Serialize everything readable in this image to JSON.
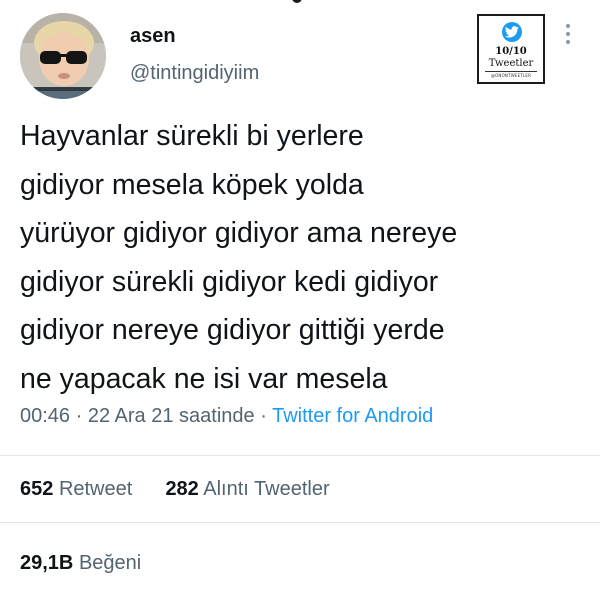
{
  "user": {
    "display_name": "asen",
    "handle": "@tintingidiyiim",
    "avatar_icon": "profile-photo"
  },
  "watermark": {
    "score": "10/10",
    "label": "Tweetler",
    "sub": "@ONONTWEETLER",
    "icon": "twitter-bird-icon",
    "accent": "#1d9bf0"
  },
  "tweet": {
    "lines": [
      "Hayvanlar sürekli bi yerlere",
      "gidiyor mesela köpek yolda",
      "yürüyor gidiyor gidiyor ama nereye",
      "gidiyor sürekli gidiyor kedi gidiyor",
      "gidiyor nereye gidiyor gittiği yerde",
      "ne yapacak ne isi var mesela"
    ],
    "time": "00:46",
    "separator": "·",
    "date": "22 Ara 21 saatinde",
    "source": "Twitter for Android"
  },
  "stats": {
    "retweets": "652",
    "retweets_label": "Retweet",
    "quotes": "282",
    "quotes_label": "Alıntı Tweetler",
    "likes": "29,1B",
    "likes_label": "Beğeni"
  },
  "colors": {
    "text": "#0f1419",
    "secondary": "#536471",
    "link": "#1d9bf0",
    "divider": "#e4e7ea"
  }
}
